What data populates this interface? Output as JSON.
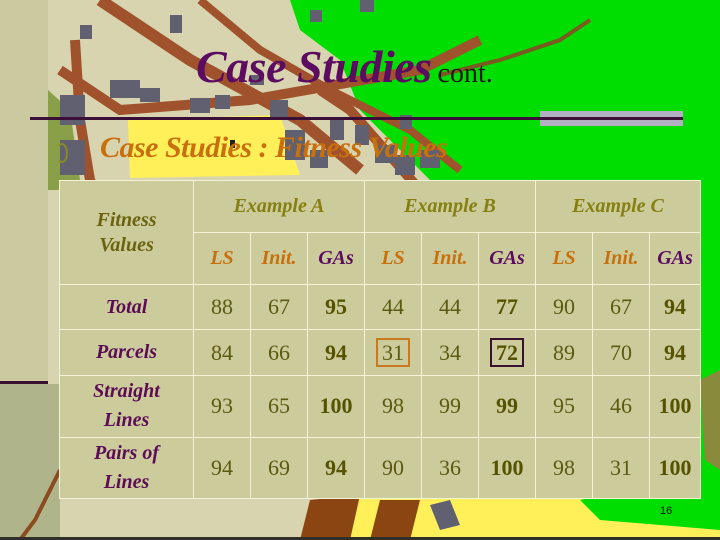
{
  "slide": {
    "title": "Case Studies",
    "title_suffix": "cont.",
    "subtitle": "Case Studies : Fitness Values",
    "slide_number": "16",
    "colors": {
      "title": "#5b0c60",
      "subtitle": "#c8700e",
      "table_bg": "#cccb9c",
      "map_green": "#00dd00",
      "highlight_orange": "#c87a20",
      "highlight_purple": "#3a1030"
    }
  },
  "table": {
    "corner_header_line1": "Fitness",
    "corner_header_line2": "Values",
    "examples": [
      "Example A",
      "Example B",
      "Example C"
    ],
    "sub_headers": [
      "LS",
      "Init.",
      "GAs"
    ],
    "rows": [
      {
        "label_line1": "Total",
        "label_line2": "",
        "values": [
          "88",
          "67",
          "95",
          "44",
          "44",
          "77",
          "90",
          "67",
          "94"
        ]
      },
      {
        "label_line1": "Parcels",
        "label_line2": "",
        "values": [
          "84",
          "66",
          "94",
          "31",
          "34",
          "72",
          "89",
          "70",
          "94"
        ]
      },
      {
        "label_line1": "Straight",
        "label_line2": "Lines",
        "values": [
          "93",
          "65",
          "100",
          "98",
          "99",
          "99",
          "95",
          "46",
          "100"
        ]
      },
      {
        "label_line1": "Pairs of",
        "label_line2": "Lines",
        "values": [
          "94",
          "69",
          "94",
          "90",
          "36",
          "100",
          "98",
          "31",
          "100"
        ]
      }
    ],
    "highlighted_cells": [
      {
        "row": "Parcels",
        "column": "Example B LS",
        "value": "31",
        "box_color": "orange"
      },
      {
        "row": "Parcels",
        "column": "Example B GAs",
        "value": "72",
        "box_color": "purple"
      }
    ]
  }
}
